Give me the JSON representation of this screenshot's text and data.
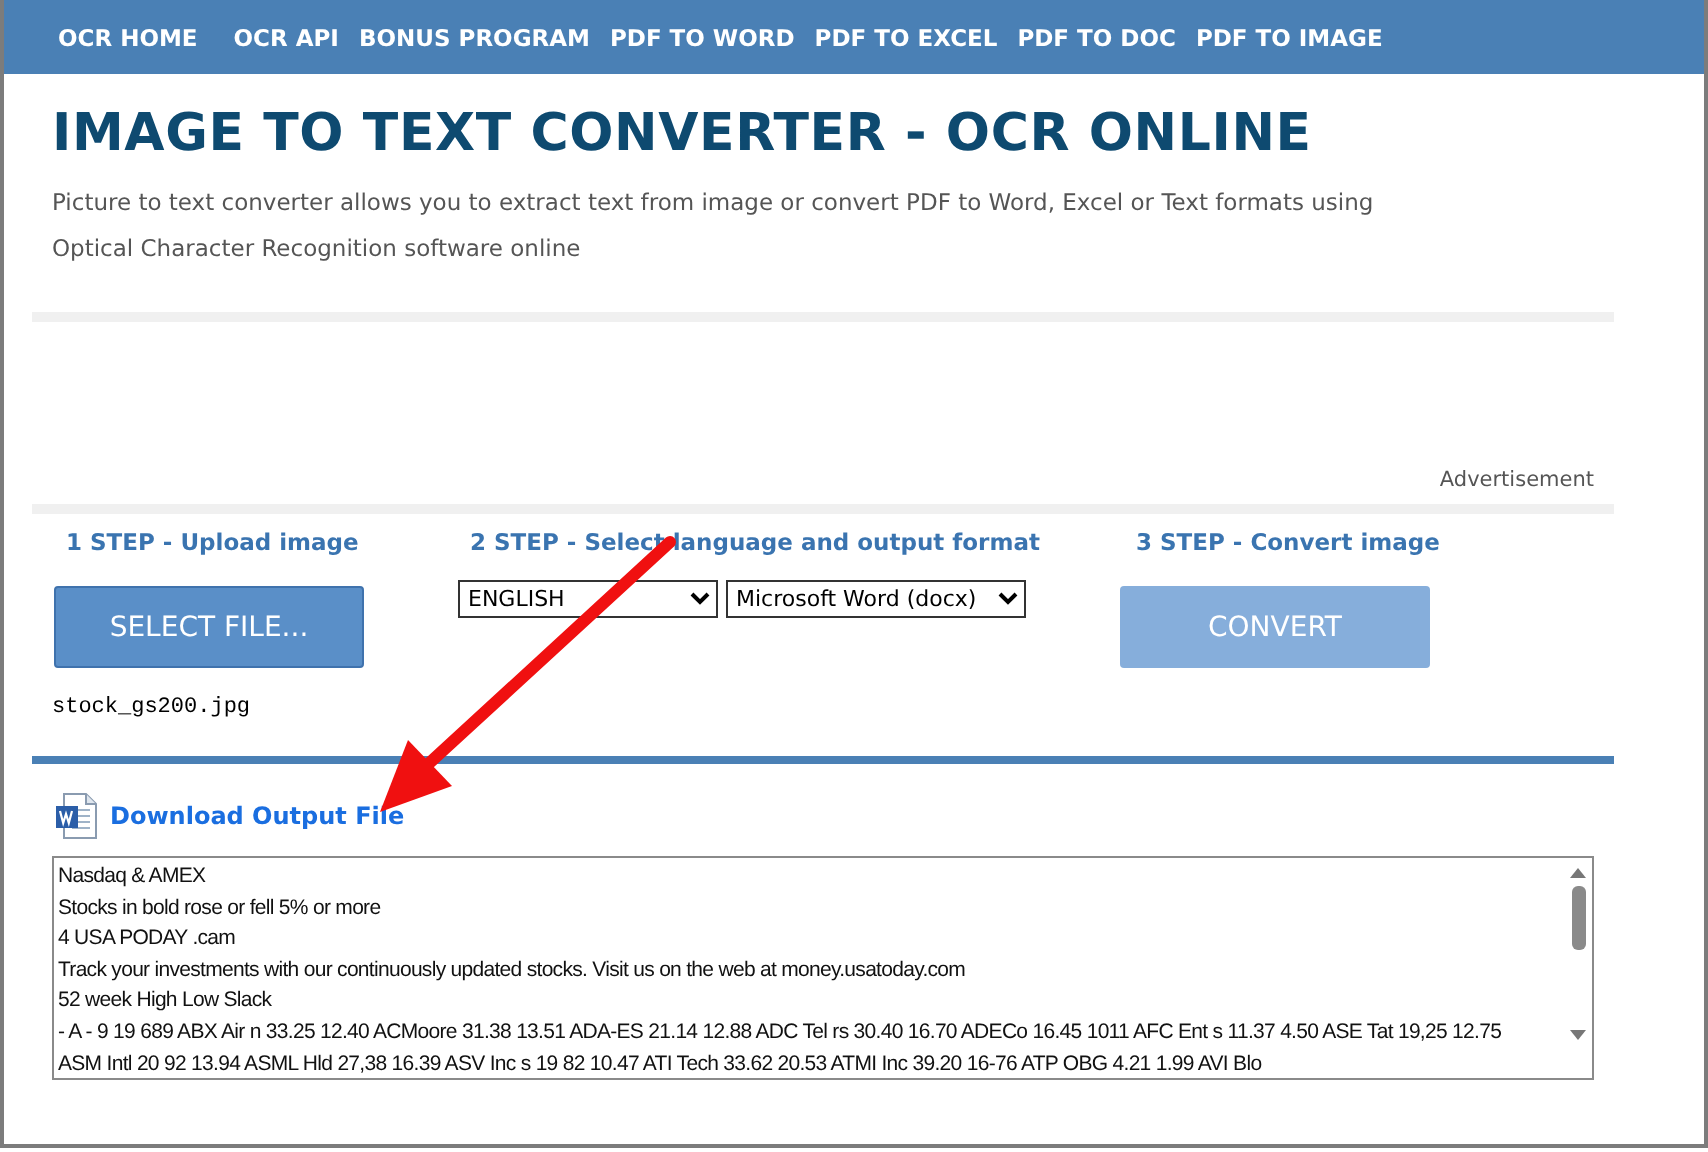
{
  "nav": [
    "OCR HOME",
    "OCR API",
    "BONUS PROGRAM",
    "PDF TO WORD",
    "PDF TO EXCEL",
    "PDF TO DOC",
    "PDF TO IMAGE"
  ],
  "title": "IMAGE TO TEXT CONVERTER - OCR ONLINE",
  "description": "Picture to text converter allows you to extract text from image or convert PDF to Word, Excel or Text formats using Optical Character Recognition software online",
  "ad_label": "Advertisement",
  "steps": [
    {
      "label": "1 STEP - Upload image"
    },
    {
      "label": "2 STEP - Select language and output format"
    },
    {
      "label": "3 STEP - Convert image"
    }
  ],
  "select_file_button": "SELECT FILE...",
  "language_select": "ENGLISH",
  "format_select": "Microsoft Word (docx)",
  "convert_button": {
    "label": "CONVERT",
    "disabled": true
  },
  "file_name": "stock_gs200.jpg",
  "download_link": "Download Output File",
  "output_lines": [
    "Nasdaq & AMEX",
    "Stocks in bold rose or fell 5% or more",
    "4 USA PODAY .cam",
    "Track your investments with our continuously updated stocks. Visit us on the web at money.usatoday.com",
    "52 week High Low Slack",
    "- A - 9 19 689 ABX Air n 33.25 12.40 ACMoore 31.38 13.51 ADA-ES 21.14 12.88 ADC Tel rs 30.40 16.70 ADECo 16.45 1011 AFC Ent s 11.37 4.50 ASE Tat 19,25 12.75",
    "ASM Intl 20 92 13.94 ASML Hld 27,38 16.39 ASV Inc s 19 82 10.47 ATI Tech 33.62 20.53 ATMI Inc 39.20 16-76 ATP OBG 4.21 1.99 AVI Blo"
  ],
  "annotation": {
    "kind": "arrow"
  }
}
